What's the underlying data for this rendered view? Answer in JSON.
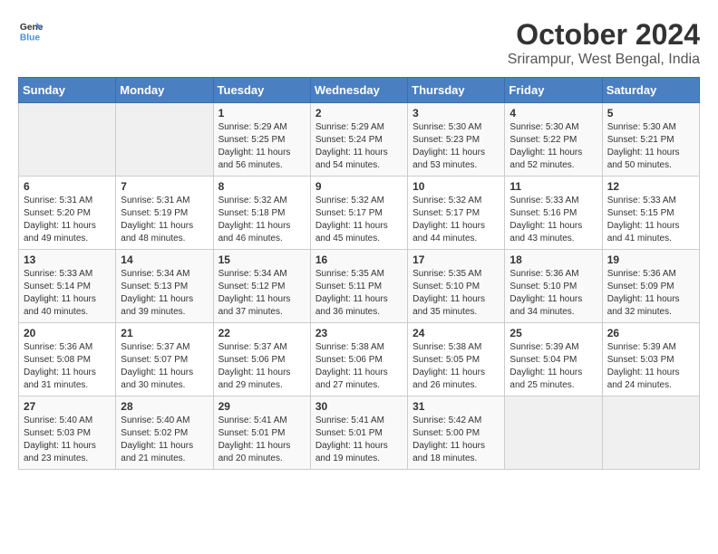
{
  "logo": {
    "line1": "General",
    "line2": "Blue"
  },
  "title": "October 2024",
  "subtitle": "Srirampur, West Bengal, India",
  "days_of_week": [
    "Sunday",
    "Monday",
    "Tuesday",
    "Wednesday",
    "Thursday",
    "Friday",
    "Saturday"
  ],
  "weeks": [
    [
      {
        "day": "",
        "sunrise": "",
        "sunset": "",
        "daylight": ""
      },
      {
        "day": "",
        "sunrise": "",
        "sunset": "",
        "daylight": ""
      },
      {
        "day": "1",
        "sunrise": "Sunrise: 5:29 AM",
        "sunset": "Sunset: 5:25 PM",
        "daylight": "Daylight: 11 hours and 56 minutes."
      },
      {
        "day": "2",
        "sunrise": "Sunrise: 5:29 AM",
        "sunset": "Sunset: 5:24 PM",
        "daylight": "Daylight: 11 hours and 54 minutes."
      },
      {
        "day": "3",
        "sunrise": "Sunrise: 5:30 AM",
        "sunset": "Sunset: 5:23 PM",
        "daylight": "Daylight: 11 hours and 53 minutes."
      },
      {
        "day": "4",
        "sunrise": "Sunrise: 5:30 AM",
        "sunset": "Sunset: 5:22 PM",
        "daylight": "Daylight: 11 hours and 52 minutes."
      },
      {
        "day": "5",
        "sunrise": "Sunrise: 5:30 AM",
        "sunset": "Sunset: 5:21 PM",
        "daylight": "Daylight: 11 hours and 50 minutes."
      }
    ],
    [
      {
        "day": "6",
        "sunrise": "Sunrise: 5:31 AM",
        "sunset": "Sunset: 5:20 PM",
        "daylight": "Daylight: 11 hours and 49 minutes."
      },
      {
        "day": "7",
        "sunrise": "Sunrise: 5:31 AM",
        "sunset": "Sunset: 5:19 PM",
        "daylight": "Daylight: 11 hours and 48 minutes."
      },
      {
        "day": "8",
        "sunrise": "Sunrise: 5:32 AM",
        "sunset": "Sunset: 5:18 PM",
        "daylight": "Daylight: 11 hours and 46 minutes."
      },
      {
        "day": "9",
        "sunrise": "Sunrise: 5:32 AM",
        "sunset": "Sunset: 5:17 PM",
        "daylight": "Daylight: 11 hours and 45 minutes."
      },
      {
        "day": "10",
        "sunrise": "Sunrise: 5:32 AM",
        "sunset": "Sunset: 5:17 PM",
        "daylight": "Daylight: 11 hours and 44 minutes."
      },
      {
        "day": "11",
        "sunrise": "Sunrise: 5:33 AM",
        "sunset": "Sunset: 5:16 PM",
        "daylight": "Daylight: 11 hours and 43 minutes."
      },
      {
        "day": "12",
        "sunrise": "Sunrise: 5:33 AM",
        "sunset": "Sunset: 5:15 PM",
        "daylight": "Daylight: 11 hours and 41 minutes."
      }
    ],
    [
      {
        "day": "13",
        "sunrise": "Sunrise: 5:33 AM",
        "sunset": "Sunset: 5:14 PM",
        "daylight": "Daylight: 11 hours and 40 minutes."
      },
      {
        "day": "14",
        "sunrise": "Sunrise: 5:34 AM",
        "sunset": "Sunset: 5:13 PM",
        "daylight": "Daylight: 11 hours and 39 minutes."
      },
      {
        "day": "15",
        "sunrise": "Sunrise: 5:34 AM",
        "sunset": "Sunset: 5:12 PM",
        "daylight": "Daylight: 11 hours and 37 minutes."
      },
      {
        "day": "16",
        "sunrise": "Sunrise: 5:35 AM",
        "sunset": "Sunset: 5:11 PM",
        "daylight": "Daylight: 11 hours and 36 minutes."
      },
      {
        "day": "17",
        "sunrise": "Sunrise: 5:35 AM",
        "sunset": "Sunset: 5:10 PM",
        "daylight": "Daylight: 11 hours and 35 minutes."
      },
      {
        "day": "18",
        "sunrise": "Sunrise: 5:36 AM",
        "sunset": "Sunset: 5:10 PM",
        "daylight": "Daylight: 11 hours and 34 minutes."
      },
      {
        "day": "19",
        "sunrise": "Sunrise: 5:36 AM",
        "sunset": "Sunset: 5:09 PM",
        "daylight": "Daylight: 11 hours and 32 minutes."
      }
    ],
    [
      {
        "day": "20",
        "sunrise": "Sunrise: 5:36 AM",
        "sunset": "Sunset: 5:08 PM",
        "daylight": "Daylight: 11 hours and 31 minutes."
      },
      {
        "day": "21",
        "sunrise": "Sunrise: 5:37 AM",
        "sunset": "Sunset: 5:07 PM",
        "daylight": "Daylight: 11 hours and 30 minutes."
      },
      {
        "day": "22",
        "sunrise": "Sunrise: 5:37 AM",
        "sunset": "Sunset: 5:06 PM",
        "daylight": "Daylight: 11 hours and 29 minutes."
      },
      {
        "day": "23",
        "sunrise": "Sunrise: 5:38 AM",
        "sunset": "Sunset: 5:06 PM",
        "daylight": "Daylight: 11 hours and 27 minutes."
      },
      {
        "day": "24",
        "sunrise": "Sunrise: 5:38 AM",
        "sunset": "Sunset: 5:05 PM",
        "daylight": "Daylight: 11 hours and 26 minutes."
      },
      {
        "day": "25",
        "sunrise": "Sunrise: 5:39 AM",
        "sunset": "Sunset: 5:04 PM",
        "daylight": "Daylight: 11 hours and 25 minutes."
      },
      {
        "day": "26",
        "sunrise": "Sunrise: 5:39 AM",
        "sunset": "Sunset: 5:03 PM",
        "daylight": "Daylight: 11 hours and 24 minutes."
      }
    ],
    [
      {
        "day": "27",
        "sunrise": "Sunrise: 5:40 AM",
        "sunset": "Sunset: 5:03 PM",
        "daylight": "Daylight: 11 hours and 23 minutes."
      },
      {
        "day": "28",
        "sunrise": "Sunrise: 5:40 AM",
        "sunset": "Sunset: 5:02 PM",
        "daylight": "Daylight: 11 hours and 21 minutes."
      },
      {
        "day": "29",
        "sunrise": "Sunrise: 5:41 AM",
        "sunset": "Sunset: 5:01 PM",
        "daylight": "Daylight: 11 hours and 20 minutes."
      },
      {
        "day": "30",
        "sunrise": "Sunrise: 5:41 AM",
        "sunset": "Sunset: 5:01 PM",
        "daylight": "Daylight: 11 hours and 19 minutes."
      },
      {
        "day": "31",
        "sunrise": "Sunrise: 5:42 AM",
        "sunset": "Sunset: 5:00 PM",
        "daylight": "Daylight: 11 hours and 18 minutes."
      },
      {
        "day": "",
        "sunrise": "",
        "sunset": "",
        "daylight": ""
      },
      {
        "day": "",
        "sunrise": "",
        "sunset": "",
        "daylight": ""
      }
    ]
  ]
}
